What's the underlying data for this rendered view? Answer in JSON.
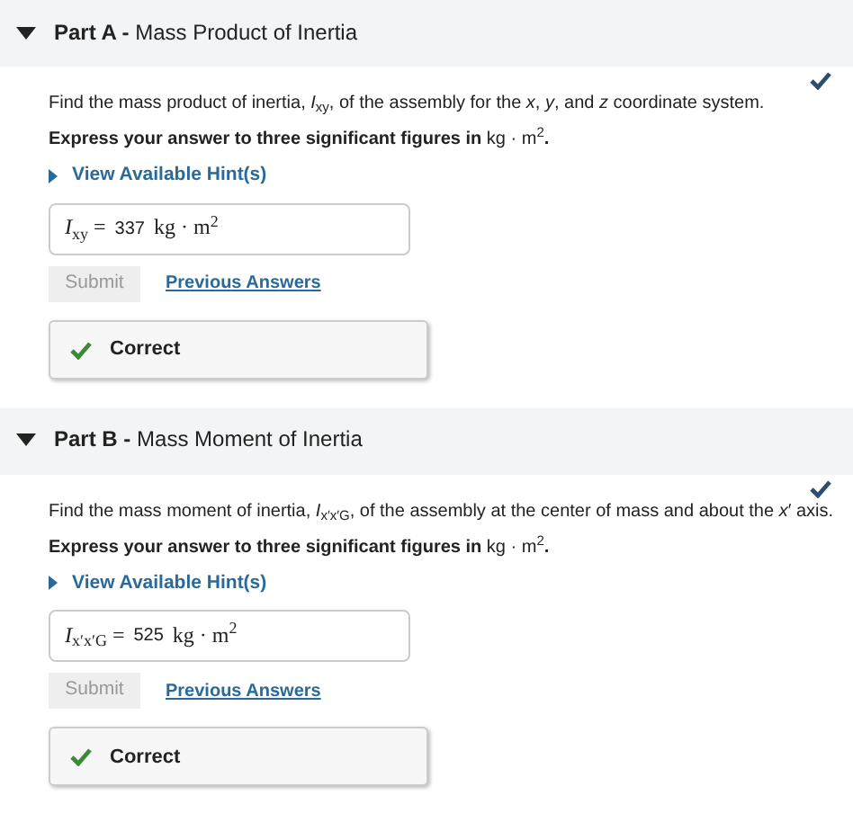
{
  "parts": [
    {
      "label": "Part A -",
      "title": "Mass Product of Inertia",
      "expanded": true,
      "completed": true,
      "question": "Find the mass product of inertia, *I*$_{xy}$, of the assembly for the *x*, *y*, and *z* coordinate system.",
      "instruction": "**Express your answer to three significant figures in** kg · m$^{2}$**.**",
      "hint": {
        "label": "View Available Hint(s)",
        "expanded": false
      },
      "answer": {
        "variable": "*I*$_{xy}$ =",
        "value": "337",
        "unit": "kg · m$^{2}$"
      },
      "submit": {
        "label": "Submit",
        "disabled": true
      },
      "previous": "Previous Answers",
      "feedback": {
        "kind": "correct",
        "text": "Correct"
      }
    },
    {
      "label": "Part B -",
      "title": "Mass Moment of Inertia",
      "expanded": true,
      "completed": true,
      "question": "Find the mass moment of inertia, *I*$_{x′x′G}$, of the assembly at the center of mass and about the *x*′ axis.",
      "instruction": "**Express your answer to three significant figures in** kg · m$^{2}$**.**",
      "hint": {
        "label": "View Available Hint(s)",
        "expanded": false
      },
      "answer": {
        "variable": "*I*$_{x′x′G}$ =",
        "value": "525",
        "unit": "kg · m$^{2}$"
      },
      "submit": {
        "label": "Submit",
        "disabled": true
      },
      "previous": "Previous Answers",
      "feedback": {
        "kind": "correct",
        "text": "Correct"
      }
    }
  ]
}
